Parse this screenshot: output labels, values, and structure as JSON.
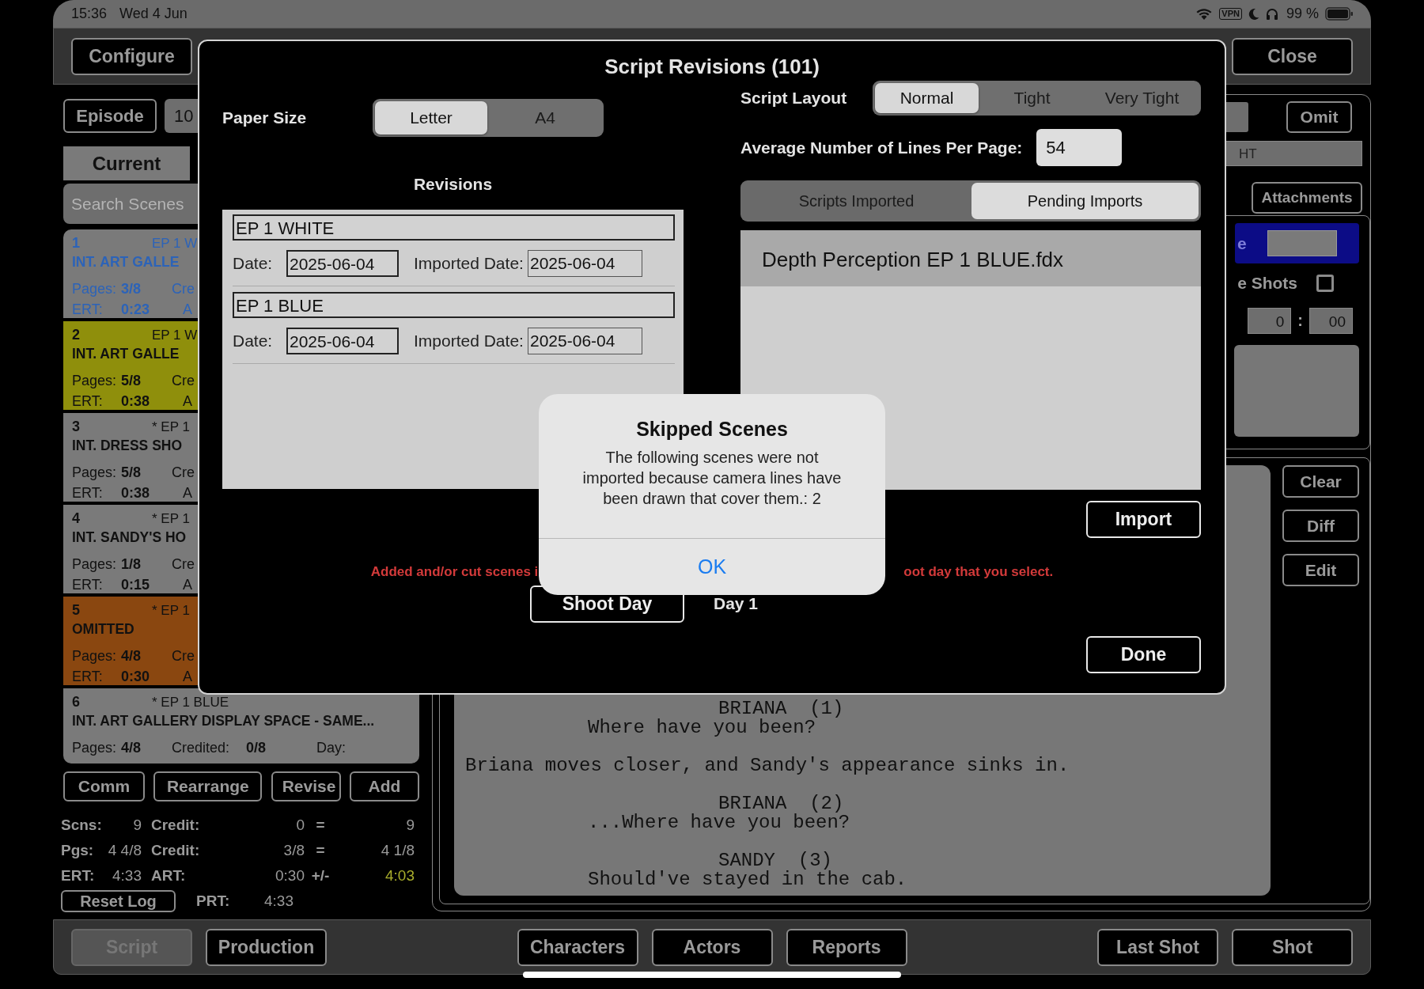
{
  "status_bar": {
    "time": "15:36",
    "date": "Wed 4 Jun",
    "vpn": "VPN",
    "battery": "99 %"
  },
  "toolbar": {
    "left_button": "Configure",
    "right_button": "Close"
  },
  "left_panel": {
    "episode_button": "Episode",
    "episode_field": "10",
    "tabs": [
      {
        "label": "Current",
        "selected": true
      }
    ],
    "search": {
      "placeholder": "Search Scenes"
    },
    "scenes": [
      {
        "number": "1",
        "revision": "EP 1 W",
        "heading": "INT. ART GALLE",
        "pages_label": "Pages:",
        "pages": "3/8",
        "credit_label": "Cre",
        "ert_label": "ERT:",
        "ert": "0:23",
        "art_label": "A",
        "color": "#7a7a7a",
        "selected": true
      },
      {
        "number": "2",
        "revision": "EP 1 W",
        "heading": "INT. ART GALLE",
        "pages_label": "Pages:",
        "pages": "5/8",
        "credit_label": "Cre",
        "ert_label": "ERT:",
        "ert": "0:38",
        "art_label": "A",
        "color": "#8f8f0c",
        "selected": false
      },
      {
        "number": "3",
        "revision": "* EP 1",
        "heading": "INT. DRESS SHO",
        "pages_label": "Pages:",
        "pages": "5/8",
        "credit_label": "Cre",
        "ert_label": "ERT:",
        "ert": "0:38",
        "art_label": "A",
        "color": "#7a7a7a",
        "selected": false
      },
      {
        "number": "4",
        "revision": "* EP 1",
        "heading": "INT. SANDY'S HO",
        "pages_label": "Pages:",
        "pages": "1/8",
        "credit_label": "Cre",
        "ert_label": "ERT:",
        "ert": "0:15",
        "art_label": "A",
        "color": "#7a7a7a",
        "selected": false
      },
      {
        "number": "5",
        "revision": "* EP 1",
        "heading": "OMITTED",
        "pages_label": "Pages:",
        "pages": "4/8",
        "credit_label": "Cre",
        "ert_label": "ERT:",
        "ert": "0:30",
        "art_label": "A",
        "color": "#8a4710",
        "selected": false
      },
      {
        "number": "6",
        "revision": "* EP 1 BLUE",
        "heading": "INT. ART GALLERY DISPLAY SPACE - SAME...",
        "pages_label": "Pages:",
        "pages": "4/8",
        "credit_label": "Credited:",
        "credited": "0/8",
        "day_label": "Day:",
        "color": "#7a7a7a",
        "selected": false
      }
    ],
    "actions": [
      "Comm",
      "Rearrange",
      "Revise",
      "Add"
    ],
    "stats": [
      {
        "kind": "values",
        "label": "Scns:",
        "value": "9",
        "label2": "Credit:",
        "value2": "0",
        "op": "=",
        "total": "9",
        "total_highlighted": false
      },
      {
        "kind": "values",
        "label": "Pgs:",
        "value": "4 4/8",
        "label2": "Credit:",
        "value2": "3/8",
        "op": "=",
        "total": "4 1/8",
        "total_highlighted": false
      },
      {
        "kind": "values",
        "label": "ERT:",
        "value": "4:33",
        "label2": "ART:",
        "value2": "0:30",
        "op": "+/-",
        "total": "4:03",
        "total_highlighted": true
      },
      {
        "kind": "button",
        "button": "Reset Log",
        "label2": "PRT:",
        "value2": "4:33"
      }
    ]
  },
  "detail_panel": {
    "omit_button": "Omit",
    "set_field": "HT",
    "attachments_button": "Attachments",
    "blue_label": "e",
    "shots_label": "e Shots",
    "shots_checked": false,
    "time": {
      "minutes": "0",
      "separator": ":",
      "seconds": "00"
    },
    "buttons": [
      "Clear",
      "Diff",
      "Edit"
    ],
    "script_lines": [
      {
        "kind": "character",
        "text": "BRIANA  (1)"
      },
      {
        "kind": "dialogue",
        "text": "Where have you been?"
      },
      {
        "kind": "action",
        "text": "Briana moves closer, and Sandy's appearance sinks in."
      },
      {
        "kind": "character",
        "text": "BRIANA  (2)"
      },
      {
        "kind": "dialogue",
        "text": "...Where have you been?"
      },
      {
        "kind": "character",
        "text": "SANDY  (3)"
      },
      {
        "kind": "dialogue",
        "text": "Should've stayed in the cab."
      }
    ]
  },
  "bottom_bar": {
    "left": [
      {
        "label": "Script",
        "disabled": true
      },
      {
        "label": "Production",
        "disabled": false
      }
    ],
    "center": [
      {
        "label": "Characters",
        "disabled": false
      },
      {
        "label": "Actors",
        "disabled": false
      },
      {
        "label": "Reports",
        "disabled": false
      }
    ],
    "right": [
      {
        "label": "Last Shot",
        "disabled": false
      },
      {
        "label": "Shot",
        "disabled": false
      }
    ]
  },
  "modal": {
    "title": "Script Revisions (101)",
    "paper_size": {
      "label": "Paper Size",
      "options": [
        {
          "label": "Letter",
          "selected": true
        },
        {
          "label": "A4",
          "selected": false
        }
      ]
    },
    "script_layout": {
      "label": "Script Layout",
      "options": [
        {
          "label": "Normal",
          "selected": true
        },
        {
          "label": "Tight",
          "selected": false
        },
        {
          "label": "Very Tight",
          "selected": false
        }
      ]
    },
    "lines_per_page": {
      "label": "Average Number of Lines Per Page:",
      "value": "54"
    },
    "revisions": {
      "heading": "Revisions",
      "items": [
        {
          "name": "EP 1 WHITE",
          "date_label": "Date:",
          "date": "2025-06-04",
          "imported_label": "Imported Date:",
          "imported_date": "2025-06-04"
        },
        {
          "name": "EP 1 BLUE",
          "date_label": "Date:",
          "date": "2025-06-04",
          "imported_label": "Imported Date:",
          "imported_date": "2025-06-04"
        }
      ]
    },
    "import_tabs": [
      {
        "label": "Scripts Imported",
        "selected": false
      },
      {
        "label": "Pending Imports",
        "selected": true
      }
    ],
    "pending_imports": [
      {
        "name": "Depth Perception EP 1 BLUE.fdx",
        "selected": true
      }
    ],
    "import_button": "Import",
    "notice_parts": [
      "Added and/or cut scenes i",
      "oot day that you select."
    ],
    "shoot_day_button": "Shoot Day",
    "shoot_day": "Day 1",
    "done_button": "Done"
  },
  "alert": {
    "title": "Skipped Scenes",
    "message": "The following scenes were not imported because camera lines have been drawn that cover them.: 2",
    "button": "OK"
  }
}
